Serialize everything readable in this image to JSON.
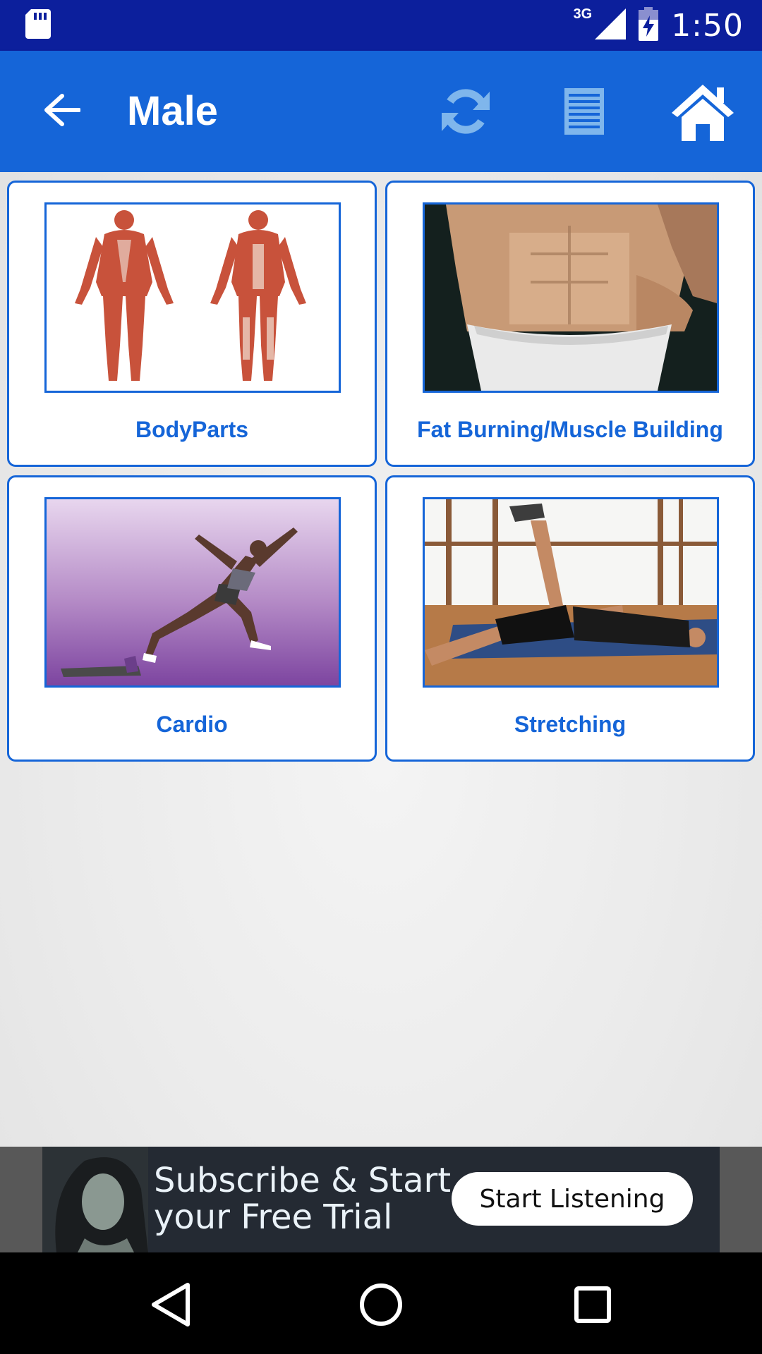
{
  "status_bar": {
    "time": "1:50",
    "network": "3G",
    "icons": [
      "sd-card-icon",
      "signal-icon",
      "battery-charging-icon"
    ]
  },
  "app_bar": {
    "title": "Male",
    "back_icon": "arrow-left-icon",
    "actions": [
      {
        "name": "refresh-icon",
        "color": "#7fb6ec"
      },
      {
        "name": "list-icon",
        "color": "#7fb6ec"
      },
      {
        "name": "home-icon",
        "color": "#ffffff"
      }
    ]
  },
  "colors": {
    "primary": "#1565d8",
    "status_bar": "#0c1f9c"
  },
  "cards": [
    {
      "label": "BodyParts"
    },
    {
      "label": "Fat Burning/Muscle Building"
    },
    {
      "label": "Cardio"
    },
    {
      "label": "Stretching"
    }
  ],
  "ad": {
    "line1": "Subscribe & Start",
    "line2": "your Free Trial",
    "button": "Start Listening"
  },
  "nav_bar": {
    "icons": [
      "nav-back-icon",
      "nav-home-icon",
      "nav-recent-icon"
    ]
  }
}
